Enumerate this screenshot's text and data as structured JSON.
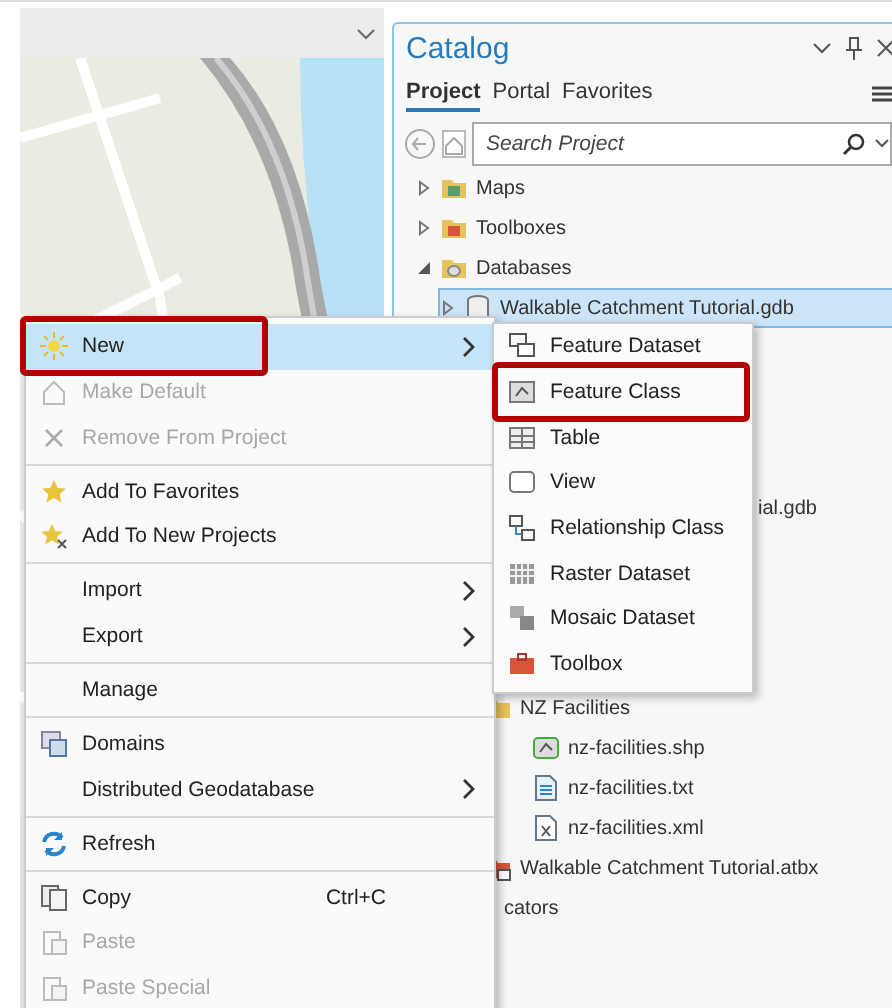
{
  "catalog": {
    "title": "Catalog",
    "tabs": [
      {
        "label": "Project",
        "selected": true
      },
      {
        "label": "Portal",
        "selected": false
      },
      {
        "label": "Favorites",
        "selected": false
      }
    ],
    "search": {
      "placeholder": "Search Project"
    },
    "tree": [
      {
        "label": "Maps",
        "expanded": false,
        "selected": false
      },
      {
        "label": "Toolboxes",
        "expanded": false,
        "selected": false
      },
      {
        "label": "Databases",
        "expanded": true,
        "selected": false,
        "children": [
          {
            "label": "Walkable Catchment Tutorial.gdb",
            "expanded": false,
            "selected": true
          }
        ]
      }
    ],
    "partial_row": "ial.gdb",
    "lower_tree": [
      {
        "label": "NZ Facilities",
        "expanded": true,
        "selected": false,
        "children": [
          {
            "label": "nz-facilities.shp",
            "selected": false
          },
          {
            "label": "nz-facilities.txt",
            "selected": false
          },
          {
            "label": "nz-facilities.xml",
            "selected": false
          }
        ]
      },
      {
        "label": "Walkable Catchment Tutorial.atbx",
        "selected": false
      },
      {
        "label": "cators",
        "selected": false
      }
    ]
  },
  "context_menu": {
    "groups": [
      [
        {
          "kind": "submenu",
          "label": "New",
          "disabled": false,
          "selected": true,
          "annotated": true
        },
        {
          "kind": "command",
          "label": "Make Default",
          "disabled": true,
          "selected": false,
          "annotated": false
        },
        {
          "kind": "command",
          "label": "Remove From Project",
          "disabled": true,
          "selected": false,
          "annotated": false
        }
      ],
      [
        {
          "kind": "command",
          "label": "Add To Favorites",
          "disabled": false,
          "selected": false,
          "annotated": false
        },
        {
          "kind": "command",
          "label": "Add To New Projects",
          "disabled": false,
          "selected": false,
          "annotated": false
        }
      ],
      [
        {
          "kind": "submenu",
          "label": "Import",
          "disabled": false,
          "selected": false,
          "annotated": false
        },
        {
          "kind": "submenu",
          "label": "Export",
          "disabled": false,
          "selected": false,
          "annotated": false
        }
      ],
      [
        {
          "kind": "command",
          "label": "Manage",
          "disabled": false,
          "selected": false,
          "annotated": false
        }
      ],
      [
        {
          "kind": "command",
          "label": "Domains",
          "disabled": false,
          "selected": false,
          "annotated": false
        },
        {
          "kind": "submenu",
          "label": "Distributed Geodatabase",
          "disabled": false,
          "selected": false,
          "annotated": false
        }
      ],
      [
        {
          "kind": "command",
          "label": "Refresh",
          "disabled": false,
          "selected": false,
          "annotated": false
        }
      ],
      [
        {
          "kind": "command",
          "label": "Copy",
          "shortcut": "Ctrl+C",
          "disabled": false,
          "selected": false,
          "annotated": false
        },
        {
          "kind": "command",
          "label": "Paste",
          "disabled": true,
          "selected": false,
          "annotated": false
        },
        {
          "kind": "command",
          "label": "Paste Special",
          "disabled": true,
          "selected": false,
          "annotated": false
        }
      ]
    ]
  },
  "submenu": {
    "items": [
      {
        "label": "Feature Dataset",
        "annotated": false
      },
      {
        "label": "Feature Class",
        "annotated": true
      },
      {
        "label": "Table",
        "annotated": false
      },
      {
        "label": "View",
        "annotated": false
      },
      {
        "label": "Relationship Class",
        "annotated": false
      },
      {
        "label": "Raster Dataset",
        "annotated": false
      },
      {
        "label": "Mosaic Dataset",
        "annotated": false
      },
      {
        "label": "Toolbox",
        "annotated": false
      }
    ]
  }
}
